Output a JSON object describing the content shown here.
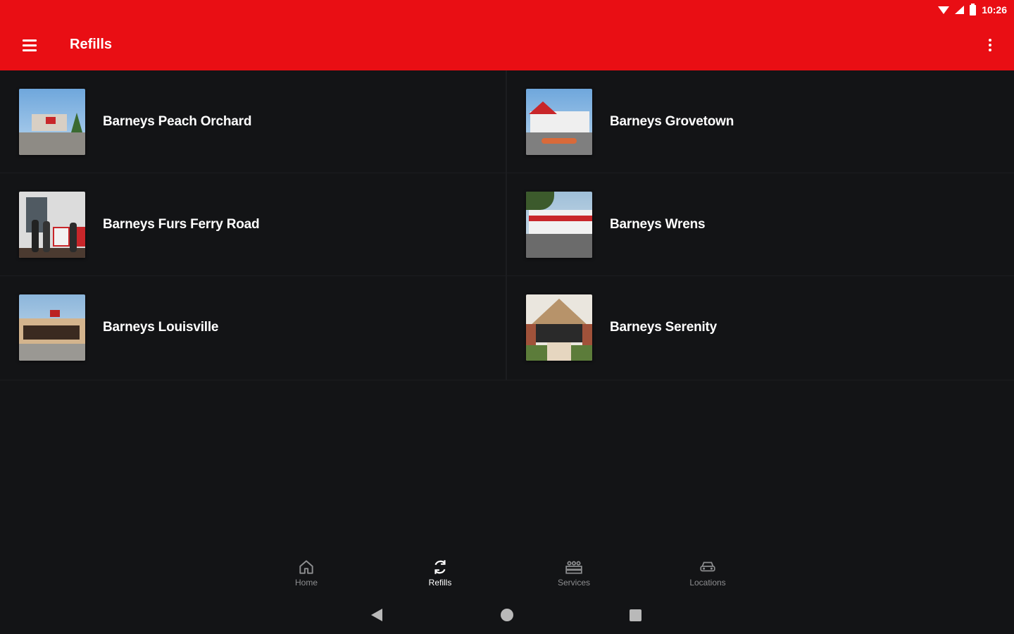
{
  "status_bar": {
    "time": "10:26"
  },
  "app_bar": {
    "title": "Refills",
    "background_color": "#e90e14"
  },
  "locations": [
    {
      "name": "Barneys Peach Orchard"
    },
    {
      "name": "Barneys Grovetown"
    },
    {
      "name": "Barneys Furs Ferry Road"
    },
    {
      "name": "Barneys Wrens"
    },
    {
      "name": "Barneys Louisville"
    },
    {
      "name": "Barneys Serenity"
    }
  ],
  "bottom_nav": {
    "items": [
      {
        "label": "Home",
        "icon": "home-icon",
        "active": false
      },
      {
        "label": "Refills",
        "icon": "refresh-icon",
        "active": true
      },
      {
        "label": "Services",
        "icon": "services-icon",
        "active": false
      },
      {
        "label": "Locations",
        "icon": "car-icon",
        "active": false
      }
    ]
  },
  "colors": {
    "background": "#131416",
    "accent": "#e90e14",
    "nav_inactive": "#8d8e90",
    "nav_active": "#ffffff"
  }
}
